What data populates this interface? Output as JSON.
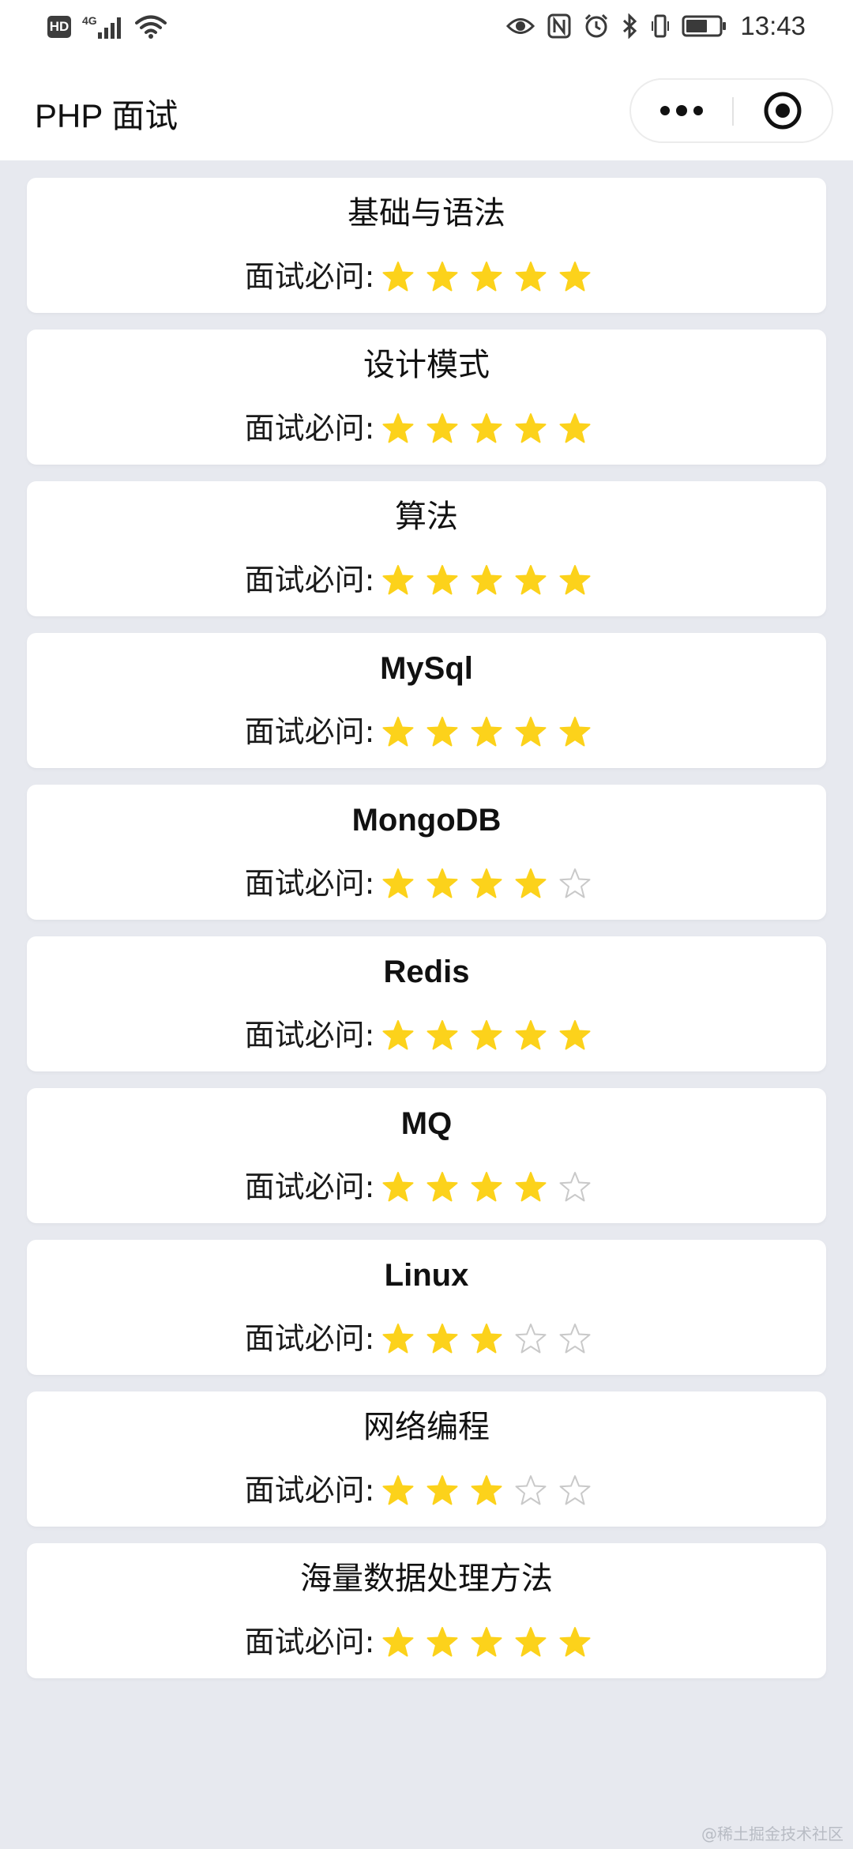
{
  "status_bar": {
    "hd": "HD",
    "network": "4G",
    "time": "13:43",
    "icons": [
      "signal-icon",
      "wifi-icon",
      "eye-icon",
      "nfc-icon",
      "alarm-icon",
      "bluetooth-icon",
      "vibrate-icon",
      "battery-icon"
    ]
  },
  "nav": {
    "title": "PHP 面试"
  },
  "items": [
    {
      "title": "基础与语法",
      "label": "面试必问:",
      "rating": 5,
      "max": 5
    },
    {
      "title": "设计模式",
      "label": "面试必问:",
      "rating": 5,
      "max": 5
    },
    {
      "title": "算法",
      "label": "面试必问:",
      "rating": 5,
      "max": 5
    },
    {
      "title": "MySql",
      "label": "面试必问:",
      "rating": 5,
      "max": 5
    },
    {
      "title": "MongoDB",
      "label": "面试必问:",
      "rating": 4,
      "max": 5
    },
    {
      "title": "Redis",
      "label": "面试必问:",
      "rating": 5,
      "max": 5
    },
    {
      "title": "MQ",
      "label": "面试必问:",
      "rating": 4,
      "max": 5
    },
    {
      "title": "Linux",
      "label": "面试必问:",
      "rating": 3,
      "max": 5
    },
    {
      "title": "网络编程",
      "label": "面试必问:",
      "rating": 3,
      "max": 5
    },
    {
      "title": "海量数据处理方法",
      "label": "面试必问:",
      "rating": 5,
      "max": 5
    }
  ],
  "colors": {
    "star_filled": "#fcd21b",
    "star_empty": "#c9c9c9"
  },
  "watermark": "@稀土掘金技术社区"
}
